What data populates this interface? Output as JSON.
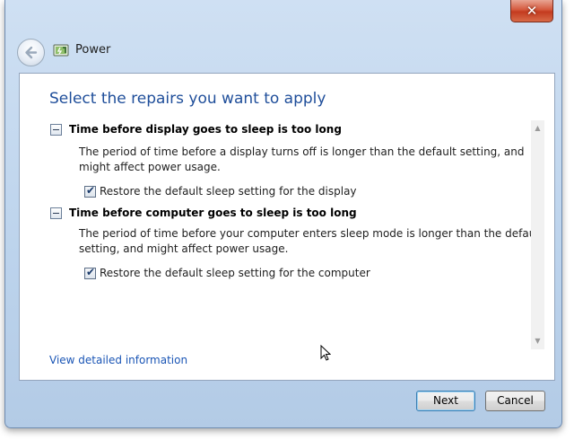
{
  "window": {
    "title": "Power",
    "close_symbol": "✕"
  },
  "content": {
    "heading": "Select the repairs you want to apply",
    "issues": [
      {
        "title": "Time before display goes to sleep is too long",
        "description_line1": "The period of time before a display turns off is longer than the default setting, and",
        "description_line2": "might affect power usage.",
        "option_label": "Restore the default sleep setting for the display",
        "option_checked": true
      },
      {
        "title": "Time before computer goes to sleep is too long",
        "description_line1": "The period of time before your computer enters sleep mode is longer than the default",
        "description_line2": "setting, and might affect power usage.",
        "option_label": "Restore the default sleep setting for the computer",
        "option_checked": true
      }
    ],
    "detail_link": "View detailed information",
    "check_glyph": "✔"
  },
  "footer": {
    "next_label": "Next",
    "cancel_label": "Cancel"
  },
  "scrollbar": {
    "up_glyph": "▲",
    "down_glyph": "▼"
  }
}
